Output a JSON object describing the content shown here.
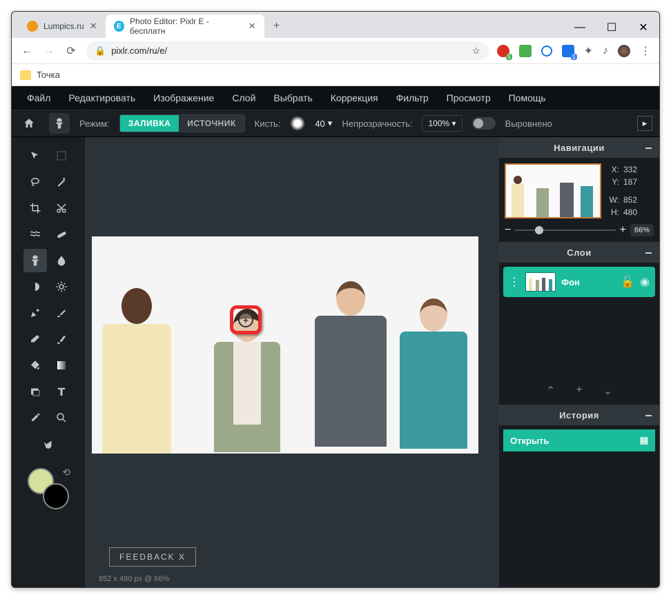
{
  "browser": {
    "tabs": [
      {
        "title": "Lumpics.ru"
      },
      {
        "title": "Photo Editor: Pixlr E - бесплатн"
      }
    ],
    "url": "pixlr.com/ru/e/",
    "bookmark": "Точка"
  },
  "menu": [
    "Файл",
    "Редактировать",
    "Изображение",
    "Слой",
    "Выбрать",
    "Коррекция",
    "Фильтр",
    "Просмотр",
    "Помощь"
  ],
  "options": {
    "mode_label": "Режим:",
    "mode_fill": "ЗАЛИВКА",
    "mode_source": "ИСТОЧНИК",
    "brush_label": "Кисть:",
    "brush_size": "40",
    "opacity_label": "Непрозрачность:",
    "opacity_value": "100% ▾",
    "aligned": "Выровнено"
  },
  "nav": {
    "title": "Навигации",
    "x_lbl": "X:",
    "x": "332",
    "y_lbl": "Y:",
    "y": "187",
    "w_lbl": "W:",
    "w": "852",
    "h_lbl": "H:",
    "h": "480",
    "zoom": "66%"
  },
  "layers": {
    "title": "Слои",
    "bg": "Фон"
  },
  "history": {
    "title": "История",
    "open": "Открыть"
  },
  "feedback": "FEEDBACK   X",
  "status": "852 x 480 px @ 66%"
}
